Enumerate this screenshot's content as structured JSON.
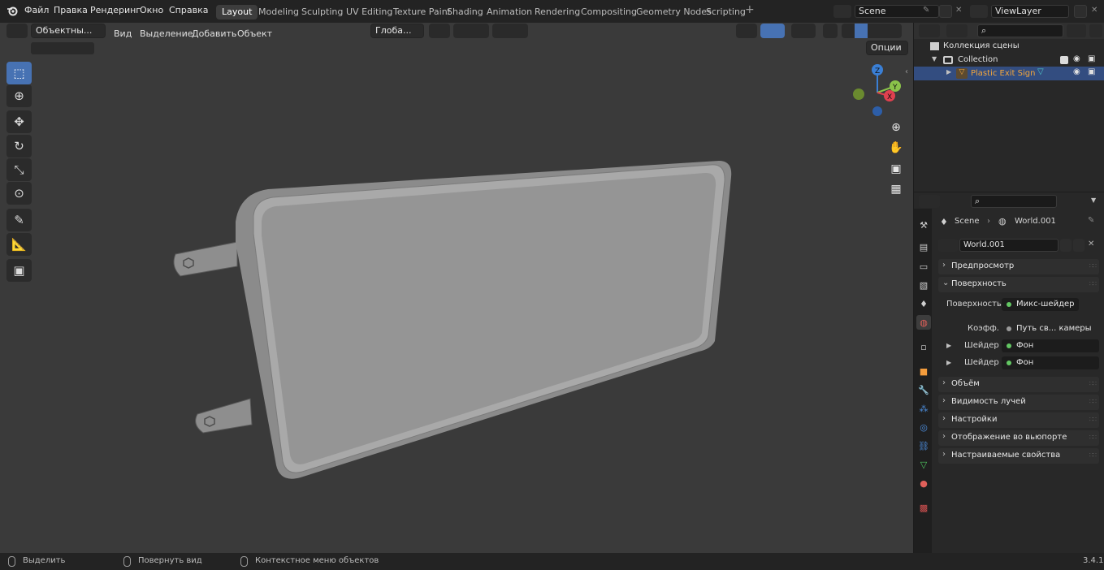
{
  "topbar": {
    "menus": [
      "Файл",
      "Правка",
      "Рендеринг",
      "Окно",
      "Справка"
    ],
    "workspaces": [
      "Layout",
      "Modeling",
      "Sculpting",
      "UV Editing",
      "Texture Paint",
      "Shading",
      "Animation",
      "Rendering",
      "Compositing",
      "Geometry Nodes",
      "Scripting"
    ],
    "active_workspace": "Layout",
    "add_tab": "+",
    "scene": "Scene",
    "view_layer": "ViewLayer"
  },
  "viewport": {
    "mode": "Объектны...",
    "menus": [
      "Вид",
      "Выделение",
      "Добавить",
      "Объект"
    ],
    "transform_orientation": "Глоба...",
    "options": "Опции",
    "gizmo": {
      "x": "X",
      "y": "Y",
      "z": "Z"
    },
    "object_name": "Plastic Exit Sign"
  },
  "toolbar": {
    "tools": [
      "select-box-icon",
      "cursor-icon",
      "move-icon",
      "rotate-icon",
      "scale-icon",
      "transform-icon",
      "annotate-icon",
      "measure-icon",
      "add-cube-icon"
    ]
  },
  "outliner": {
    "scene_collection": "Коллекция сцены",
    "collection": "Collection",
    "object": "Plastic Exit Sign"
  },
  "properties": {
    "breadcrumb_scene": "Scene",
    "breadcrumb_world": "World.001",
    "world_name": "World.001",
    "panels": {
      "preview": "Предпросмотр",
      "surface": "Поверхность",
      "volume": "Объём",
      "ray_visibility": "Видимость лучей",
      "settings": "Настройки",
      "viewport_display": "Отображение во вьюпорте",
      "custom_props": "Настраиваемые свойства"
    },
    "surface_label": "Поверхность",
    "surface_value": "Микс-шейдер",
    "fac_label": "Коэфф.",
    "fac_value": "Путь св... камеры",
    "shader1_label": "Шейдер",
    "shader1_value": "Фон",
    "shader2_label": "Шейдер",
    "shader2_value": "Фон"
  },
  "statusbar": {
    "select": "Выделить",
    "rotate_view": "Повернуть вид",
    "context_menu": "Контекстное меню объектов",
    "version": "3.4.1"
  },
  "colors": {
    "accent": "#4772b3",
    "selection": "#334d80",
    "object_text": "#f3a63c",
    "gizmo_x": "#e0404f",
    "gizmo_y": "#8bc34a",
    "gizmo_z": "#3a7fd5",
    "active_node_dot": "#63c763"
  }
}
